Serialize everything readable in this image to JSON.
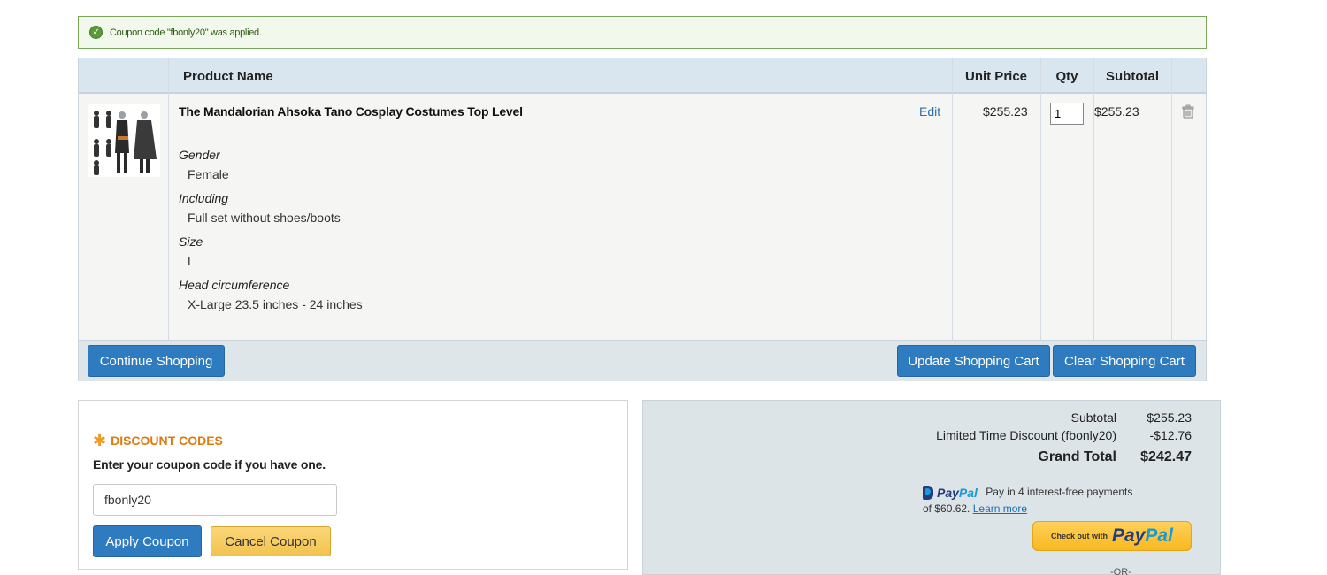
{
  "message": {
    "text": "Coupon code \"fbonly20\" was applied."
  },
  "cart": {
    "headers": {
      "product_name": "Product Name",
      "unit_price": "Unit Price",
      "qty": "Qty",
      "subtotal": "Subtotal"
    },
    "item": {
      "name": "The Mandalorian Ahsoka Tano Cosplay Costumes Top Level",
      "edit_label": "Edit",
      "unit_price": "$255.23",
      "qty": "1",
      "subtotal": "$255.23",
      "options": [
        {
          "label": "Gender",
          "value": "Female"
        },
        {
          "label": "Including",
          "value": "Full set without shoes/boots"
        },
        {
          "label": "Size",
          "value": "L"
        },
        {
          "label": "Head circumference",
          "value": "X-Large 23.5 inches - 24 inches"
        }
      ]
    },
    "buttons": {
      "continue": "Continue Shopping",
      "update": "Update Shopping Cart",
      "clear": "Clear Shopping Cart"
    }
  },
  "discount": {
    "title": "DISCOUNT CODES",
    "description": "Enter your coupon code if you have one.",
    "code_value": "fbonly20",
    "apply_label": "Apply Coupon",
    "cancel_label": "Cancel Coupon"
  },
  "totals": {
    "subtotal_label": "Subtotal",
    "subtotal_value": "$255.23",
    "discount_label": "Limited Time Discount (fbonly20)",
    "discount_value": "-$12.76",
    "grand_label": "Grand Total",
    "grand_value": "$242.47"
  },
  "paypal": {
    "logo_part1": "Pay",
    "logo_part2": "Pal",
    "pay_in_4": "Pay in 4 interest-free payments",
    "installment_text": "of $60.62.",
    "learn_more": "Learn more",
    "checkout_small": "Check out with",
    "checkout_logo_part1": "Pay",
    "checkout_logo_part2": "Pal",
    "or_text": "-OR-"
  },
  "colors": {
    "accent_blue": "#2f7bbf",
    "accent_orange": "#e07a10",
    "success_green": "#2e5c14",
    "paypal_navy": "#253b80",
    "paypal_light": "#179bd7"
  }
}
